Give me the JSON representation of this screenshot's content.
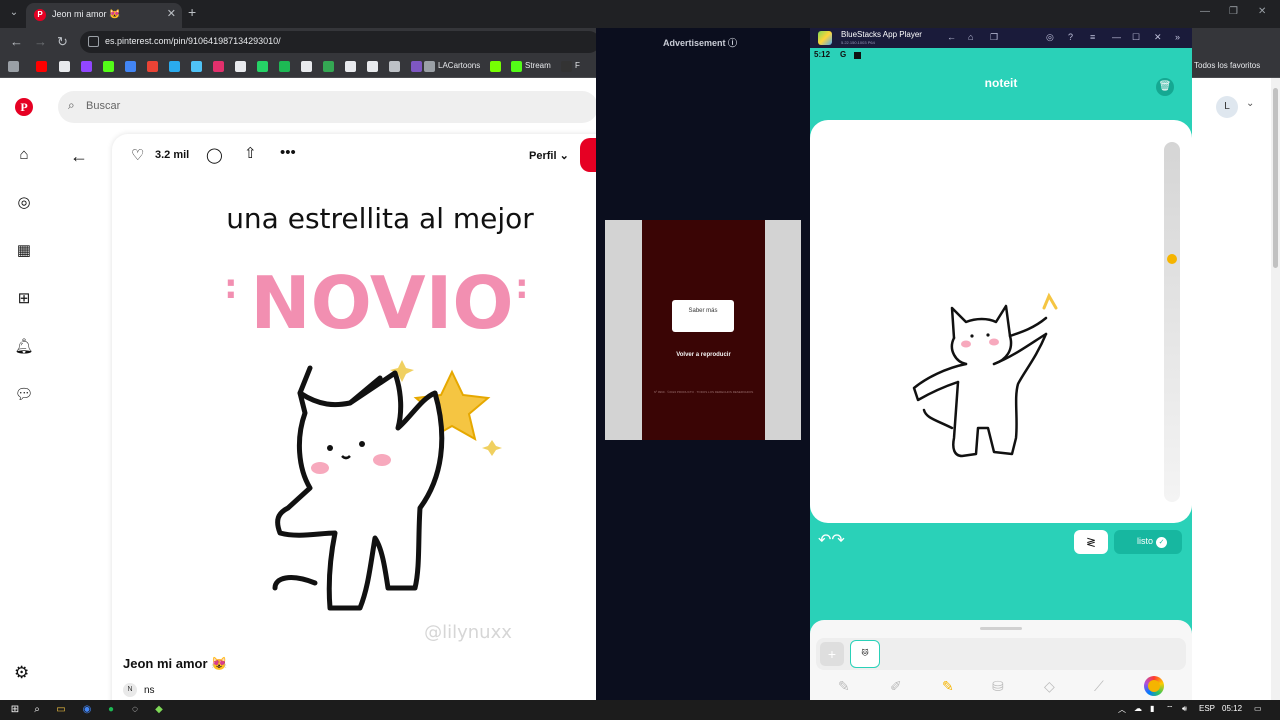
{
  "browser": {
    "tab_title": "Jeon mi amor 😻",
    "tab_close": "✕",
    "new_tab": "+",
    "url": "es.pinterest.com/pin/910641987134293010/",
    "window_controls": [
      "—",
      "❐",
      "✕"
    ]
  },
  "bookmarks": {
    "items": [
      {
        "label": "LACartoons",
        "color": "#9aa0a6"
      },
      {
        "label": "Stream",
        "color": "#1db954"
      },
      {
        "label": "F",
        "color": "#e8eaed"
      }
    ],
    "all_bookmarks": "Todos los favoritos"
  },
  "pinterest": {
    "search_placeholder": "Buscar",
    "likes": "3.2 mil",
    "profile_button": "Perfil",
    "pin_title": "Jeon mi amor 😻",
    "owner_initial": "N",
    "owner_name": "ns",
    "user_initial": "L",
    "image_text": {
      "line1": "una estrellita al mejor",
      "line2": "NOVIO",
      "watermark": "@lilynuxx"
    }
  },
  "ad": {
    "label": "Advertisement ⓘ",
    "cta": "Saber más",
    "replay": "Volver a reproducir",
    "fine_print": "Nº 9999 · ©2024 PRODUCTO · TODOS LOS DERECHOS RESERVADOS"
  },
  "bluestacks": {
    "app_name": "BlueStacks App Player",
    "version": "5.22.150.1003  P64",
    "time": "5:12",
    "status_g": "G",
    "app_title": "noteit",
    "done_label": "listo",
    "slider_level": 0.68
  },
  "taskbar": {
    "lang": "ESP",
    "clock": "05:12"
  },
  "colors": {
    "pinterest_red": "#e60023",
    "noteit_teal": "#2ad1b8",
    "star_yellow": "#f5c542",
    "novio_pink": "#f28fb1"
  }
}
